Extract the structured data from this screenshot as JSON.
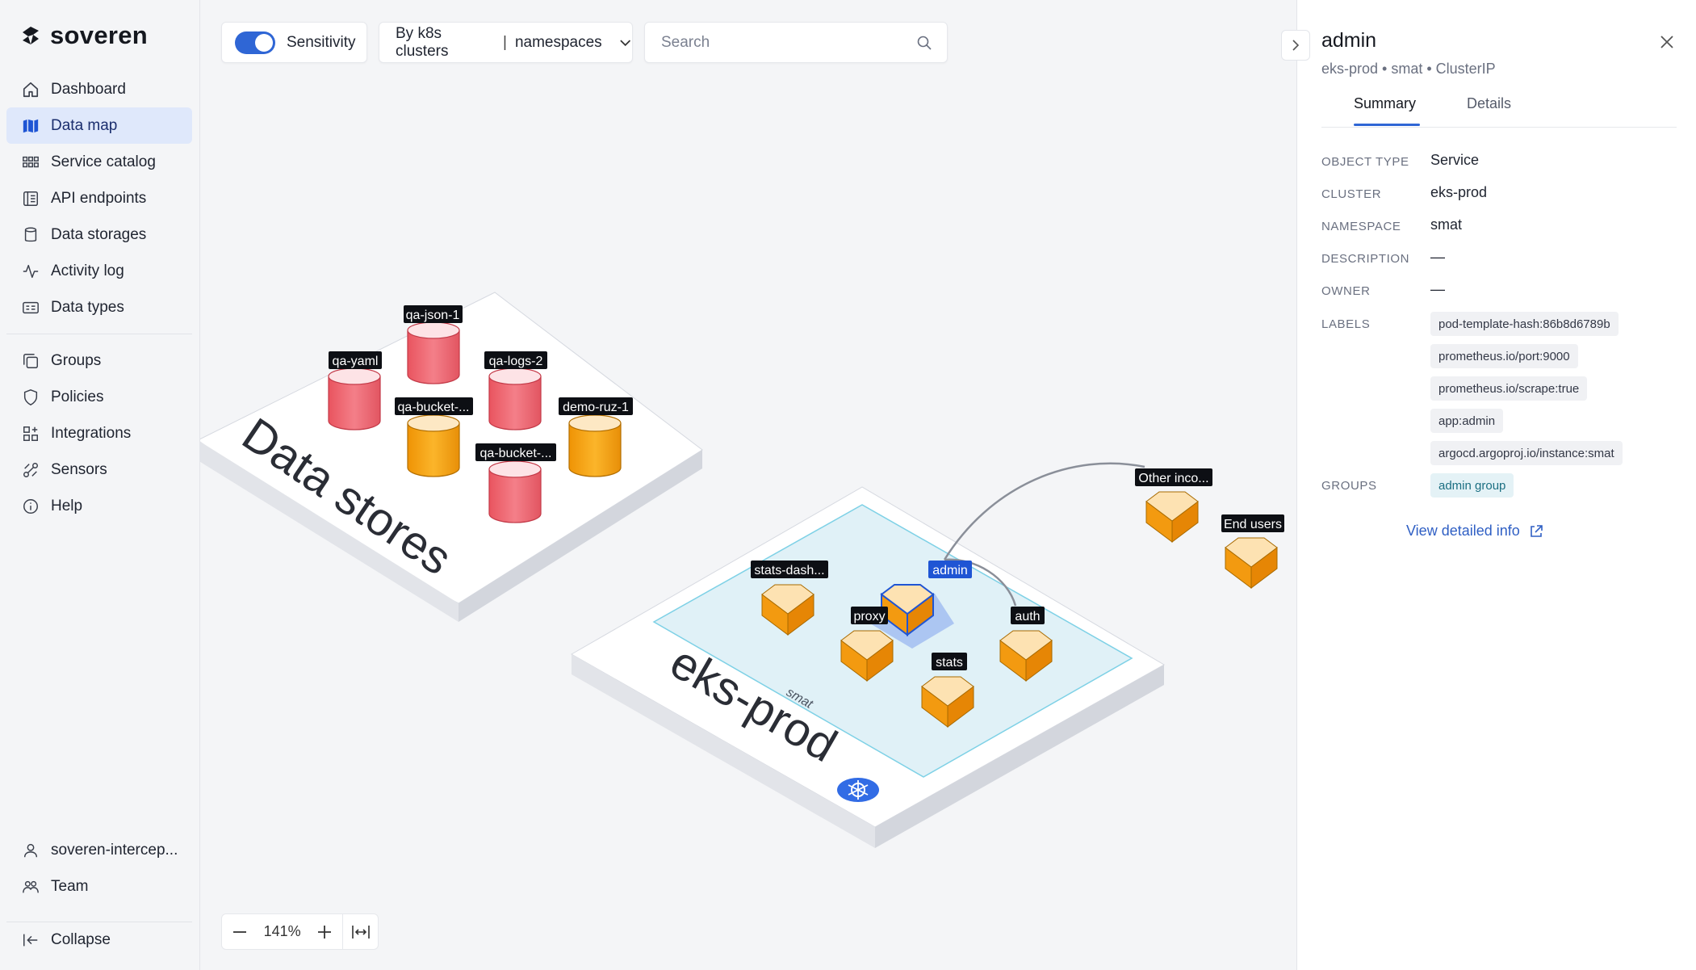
{
  "app": {
    "name": "soveren"
  },
  "sidebar": {
    "items": [
      {
        "label": "Dashboard",
        "icon": "home-icon"
      },
      {
        "label": "Data map",
        "icon": "map-icon",
        "active": true
      },
      {
        "label": "Service catalog",
        "icon": "grid-icon"
      },
      {
        "label": "API endpoints",
        "icon": "api-icon"
      },
      {
        "label": "Data storages",
        "icon": "database-icon"
      },
      {
        "label": "Activity log",
        "icon": "activity-icon"
      },
      {
        "label": "Data types",
        "icon": "id-card-icon"
      }
    ],
    "items2": [
      {
        "label": "Groups",
        "icon": "groups-icon"
      },
      {
        "label": "Policies",
        "icon": "shield-icon"
      },
      {
        "label": "Integrations",
        "icon": "integrations-icon"
      },
      {
        "label": "Sensors",
        "icon": "sensor-icon"
      },
      {
        "label": "Help",
        "icon": "info-icon"
      }
    ],
    "footer": [
      {
        "label": "soveren-intercep...",
        "icon": "user-icon"
      },
      {
        "label": "Team",
        "icon": "team-icon"
      }
    ],
    "collapse_label": "Collapse"
  },
  "toolbar": {
    "sensitivity_label": "Sensitivity",
    "sensitivity_on": true,
    "grouping_left": "By k8s clusters",
    "grouping_sep": "|",
    "grouping_right": "namespaces",
    "search_placeholder": "Search"
  },
  "map": {
    "datastores_title": "Data stores",
    "cluster_title": "eks-prod",
    "namespace_label": "smat",
    "stores": [
      "qa-json-1",
      "qa-yaml",
      "qa-logs-2",
      "qa-bucket-...",
      "demo-ruz-1",
      "qa-bucket-..."
    ],
    "services": [
      "stats-dash...",
      "admin",
      "proxy",
      "auth",
      "stats"
    ],
    "external": [
      "Other inco...",
      "End users"
    ],
    "colors": {
      "sensitive": "#f0707c",
      "normal": "#f5a00e",
      "selected": "#1f55d4",
      "namespace": "#e0f1f7"
    }
  },
  "zoom": {
    "value": "141%"
  },
  "panel": {
    "title": "admin",
    "subtitle": "eks-prod • smat • ClusterIP",
    "tabs": [
      "Summary",
      "Details"
    ],
    "active_tab": "Summary",
    "fields": {
      "object_type": {
        "key": "OBJECT TYPE",
        "value": "Service"
      },
      "cluster": {
        "key": "CLUSTER",
        "value": "eks-prod"
      },
      "namespace": {
        "key": "NAMESPACE",
        "value": "smat"
      },
      "description": {
        "key": "DESCRIPTION",
        "value": "—"
      },
      "owner": {
        "key": "OWNER",
        "value": "—"
      },
      "labels_key": "LABELS",
      "groups_key": "GROUPS"
    },
    "labels": [
      "pod-template-hash:86b8d6789b",
      "prometheus.io/port:9000",
      "prometheus.io/scrape:true",
      "app:admin",
      "argocd.argoproj.io/instance:smat"
    ],
    "groups": [
      "admin group"
    ],
    "view_link": "View detailed info"
  }
}
